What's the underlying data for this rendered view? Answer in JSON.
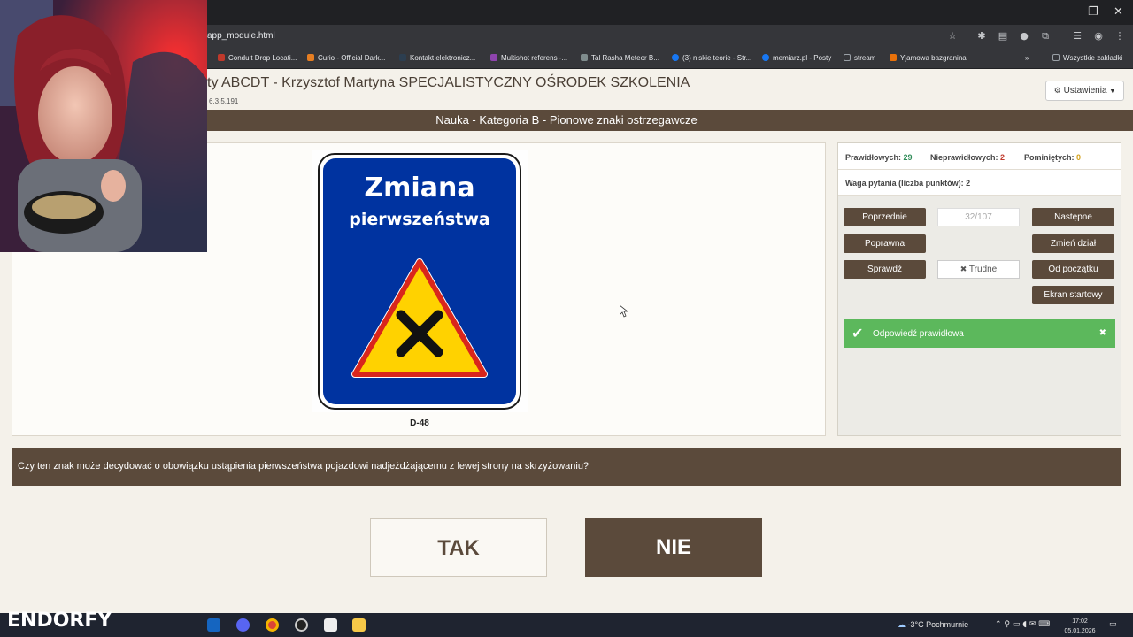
{
  "browser": {
    "url": "app_module.html",
    "window_controls": [
      "—",
      "❐",
      "✕"
    ],
    "bookmarks": [
      {
        "label": "Conduit Drop Locati...",
        "color": "#c0392b"
      },
      {
        "label": "Curio - Official Dark...",
        "color": "#e67e22"
      },
      {
        "label": "Kontakt elektronicz...",
        "color": "#2c3e50"
      },
      {
        "label": "Multishot referens -...",
        "color": "#8e44ad"
      },
      {
        "label": "Tal Rasha Meteor B...",
        "color": "#7f8c8d"
      },
      {
        "label": "(3) niskie teorie - Str...",
        "color": "#1877f2"
      },
      {
        "label": "memiarz.pl - Posty",
        "color": "#1877f2"
      },
      {
        "label": "stream",
        "color": "#9aa0a6"
      },
      {
        "label": "Yjamowa bazgranina",
        "color": "#e8710a"
      }
    ],
    "all_bookmarks": "Wszystkie zakładki"
  },
  "header": {
    "title": "ty ABCDT - Krzysztof Martyna SPECJALISTYCZNY OŚRODEK SZKOLENIA",
    "version": "6.3.5.191",
    "settings_label": "Ustawienia"
  },
  "subheader": {
    "title": "Nauka - Kategoria B - Pionowe znaki ostrzegawcze"
  },
  "sign": {
    "line1": "Zmiana",
    "line2": "pierwszeństwa",
    "code": "D-48"
  },
  "stats": {
    "correct_label": "Prawidłowych:",
    "correct_value": "29",
    "wrong_label": "Nieprawidłowych:",
    "wrong_value": "2",
    "skipped_label": "Pominiętych:",
    "skipped_value": "0",
    "weight": "Waga pytania (liczba punktów): 2"
  },
  "controls": {
    "previous": "Poprzednie",
    "counter": "32/107",
    "next": "Następne",
    "correct": "Poprawna",
    "change_section": "Zmień dział",
    "check": "Sprawdź",
    "difficult": "Trudne",
    "from_start": "Od początku",
    "start_screen": "Ekran startowy"
  },
  "feedback": {
    "message": "Odpowiedź prawidłowa"
  },
  "question": {
    "text": "Czy ten znak może decydować o obowiązku ustąpienia pierwszeństwa pojazdowi nadjeżdżającemu z lewej strony na skrzyżowaniu?"
  },
  "answers": {
    "yes": "TAK",
    "no": "NIE"
  },
  "taskbar": {
    "brand": "ENDORFY",
    "weather": "-3°C Pochmurnie",
    "time": "17:02",
    "date": "05.01.2026"
  },
  "colors": {
    "brown": "#5b4a3b",
    "success": "#5cb85c",
    "sign_blue": "#0033a0",
    "sign_yellow": "#ffd200",
    "correct_stat": "#2e8b57",
    "wrong_stat": "#c0392b",
    "skipped_stat": "#d4a017"
  }
}
